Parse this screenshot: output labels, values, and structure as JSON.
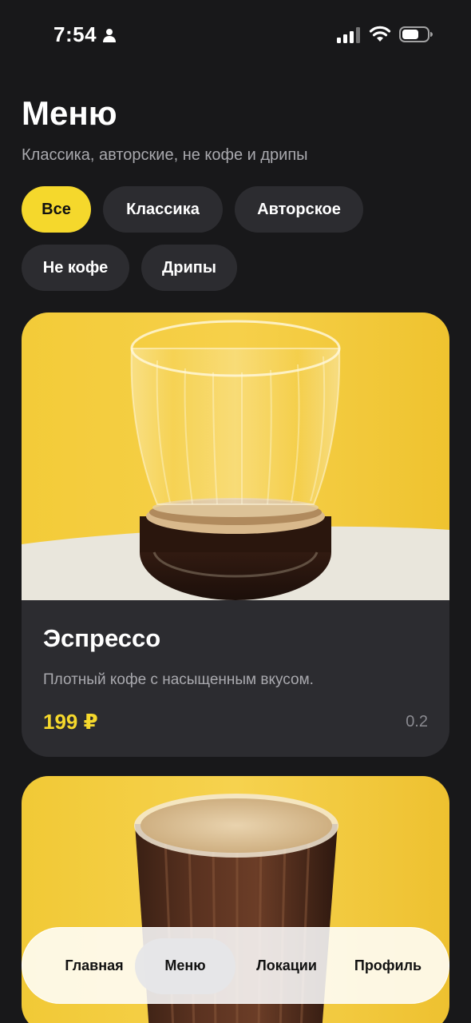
{
  "status_bar": {
    "time": "7:54",
    "icons": [
      "person-icon",
      "cellular-signal-icon",
      "wifi-icon",
      "battery-icon"
    ]
  },
  "header": {
    "title": "Меню",
    "subtitle": "Классика, авторские, не кофе и дрипы"
  },
  "filters": [
    {
      "label": "Все",
      "active": true
    },
    {
      "label": "Классика",
      "active": false
    },
    {
      "label": "Авторское",
      "active": false
    },
    {
      "label": "Не кофе",
      "active": false
    },
    {
      "label": "Дрипы",
      "active": false
    }
  ],
  "products": [
    {
      "name": "Эспрессо",
      "description": "Плотный кофе с насыщенным вкусом.",
      "price": "199 ₽",
      "volume": "0.2"
    }
  ],
  "bottom_nav": {
    "items": [
      {
        "label": "Главная",
        "active": false
      },
      {
        "label": "Меню",
        "active": true
      },
      {
        "label": "Локации",
        "active": false
      },
      {
        "label": "Профиль",
        "active": false
      }
    ]
  },
  "colors": {
    "background": "#18181a",
    "accent": "#f5d82c",
    "card": "#2c2c30",
    "chip": "#2c2c30",
    "muted_text": "#a9a9ae"
  }
}
